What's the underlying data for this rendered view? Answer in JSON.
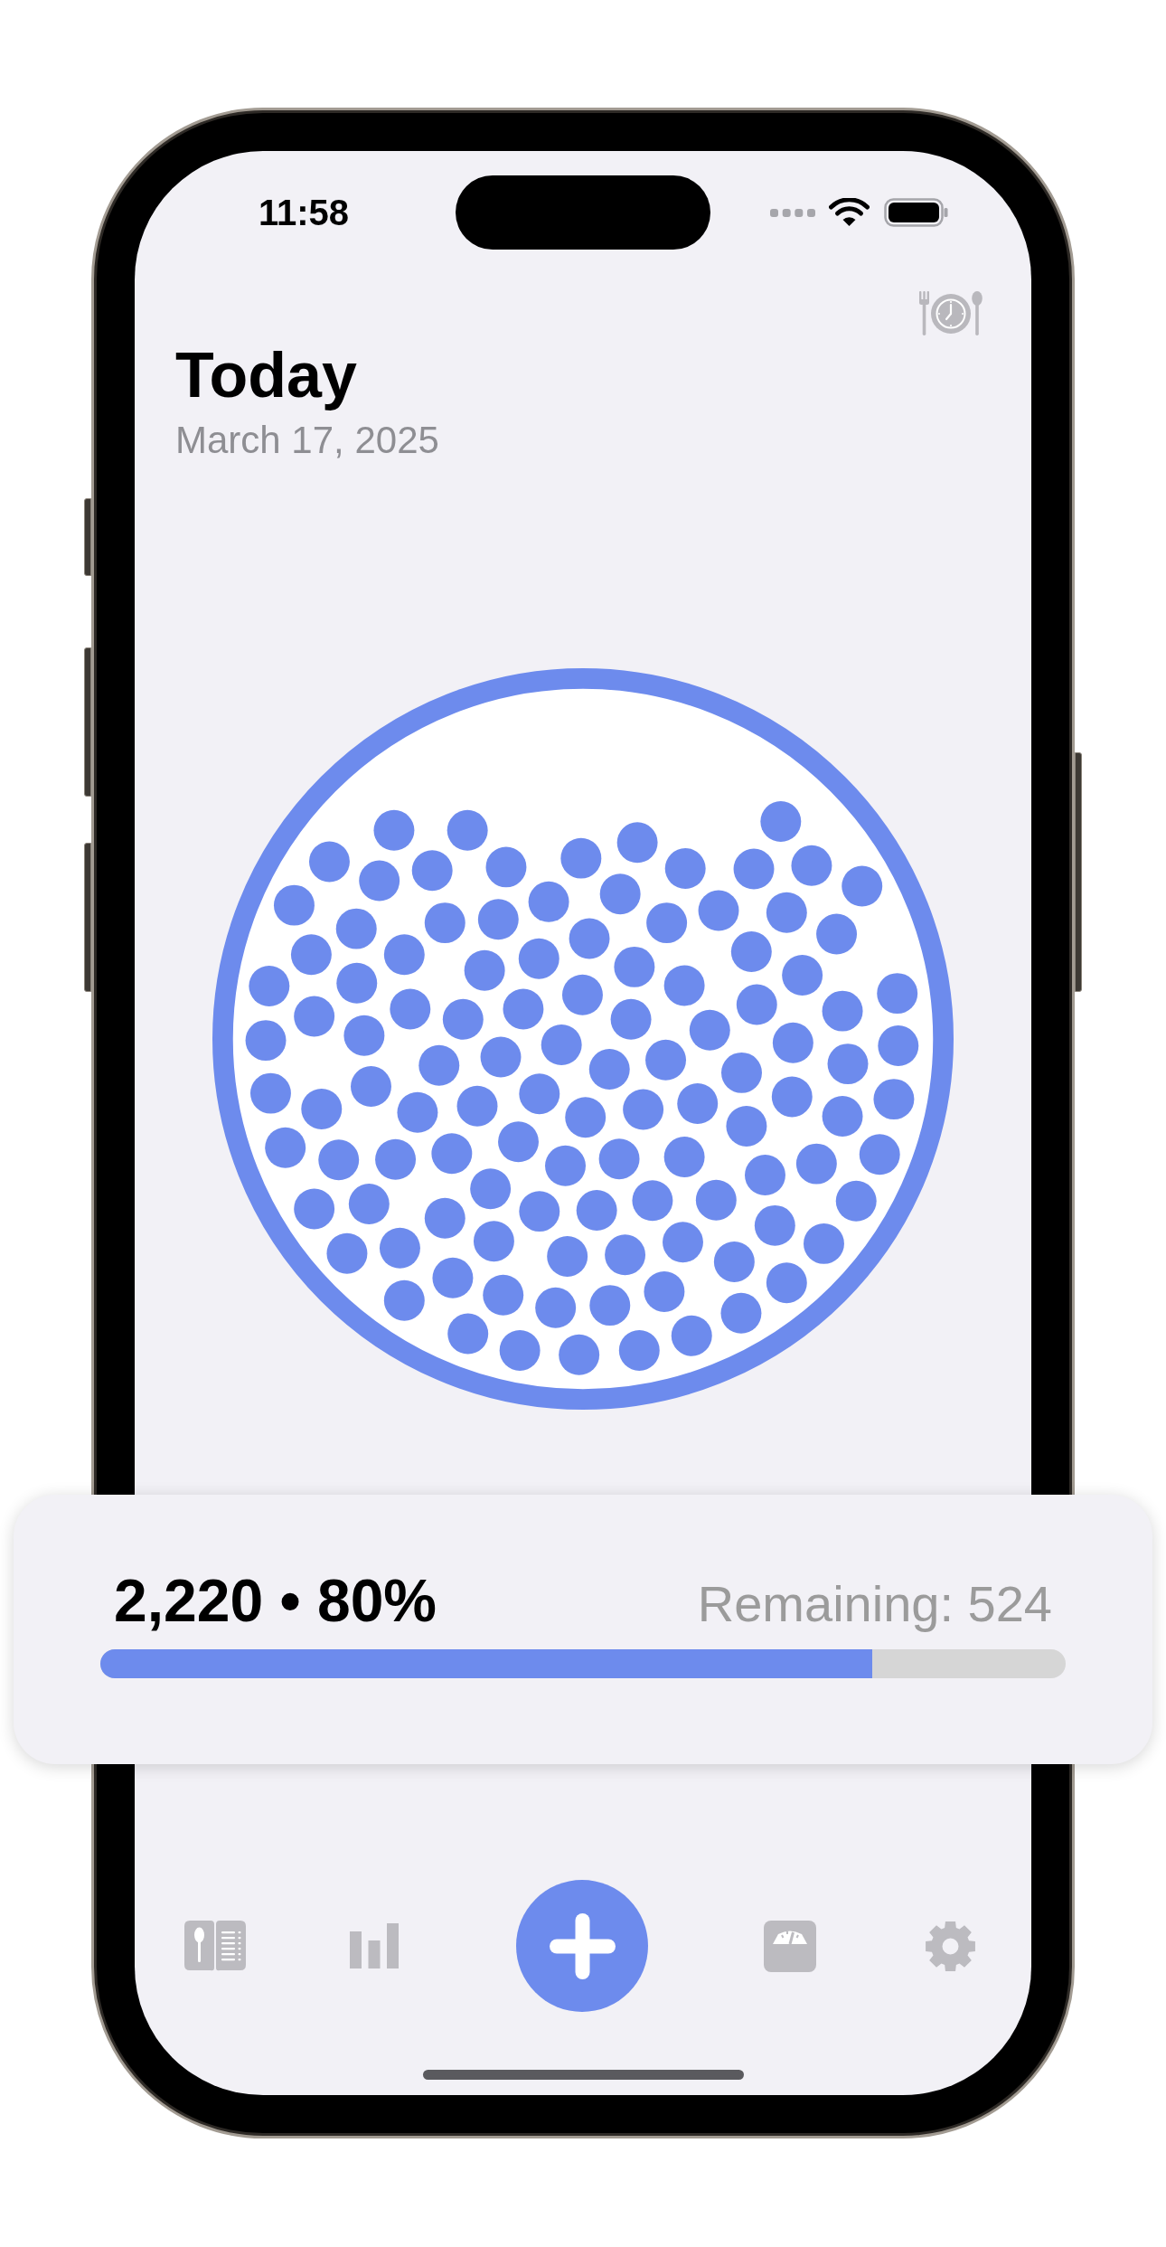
{
  "status_bar": {
    "time": "11:58"
  },
  "header": {
    "title": "Today",
    "date": "March 17, 2025"
  },
  "summary": {
    "consumed": "2,220 • 80%",
    "remaining": "Remaining: 524",
    "progress": {
      "level": 0.8
    }
  }
}
